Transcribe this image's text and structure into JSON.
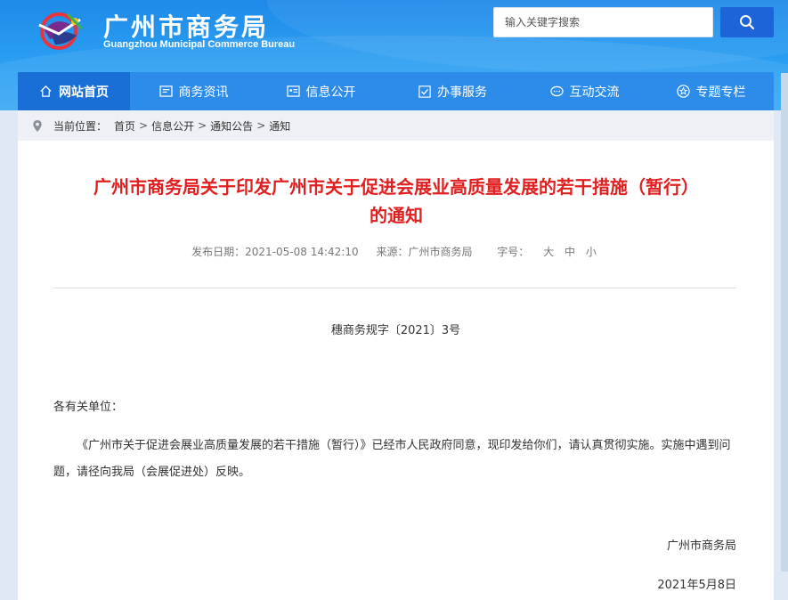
{
  "header": {
    "title": "广州市商务局",
    "subtitle": "Guangzhou Municipal Commerce Bureau",
    "search_placeholder": "输入关键字搜索"
  },
  "nav": {
    "items": [
      {
        "label": "网站首页",
        "icon": "home-icon",
        "active": true
      },
      {
        "label": "商务资讯",
        "icon": "news-icon",
        "active": false
      },
      {
        "label": "信息公开",
        "icon": "info-card-icon",
        "active": false
      },
      {
        "label": "办事服务",
        "icon": "checkbox-icon",
        "active": false
      },
      {
        "label": "互动交流",
        "icon": "chat-icon",
        "active": false
      },
      {
        "label": "专题专栏",
        "icon": "star-badge-icon",
        "active": false
      }
    ]
  },
  "breadcrumb": {
    "prefix": "当前位置：",
    "items": [
      "首页",
      "信息公开",
      "通知公告",
      "通知"
    ],
    "separator": ">"
  },
  "article": {
    "title_line1": "广州市商务局关于印发广州市关于促进会展业高质量发展的若干措施（暂行）",
    "title_line2": "的通知",
    "date": "发布日期：2021-05-08 14:42:10",
    "source": "来源：广州市商务局",
    "font_size_label": "字号：",
    "font_size_options": [
      "大",
      "中",
      "小"
    ],
    "doc_number": "穗商务规字〔2021〕3号",
    "salutation": "各有关单位：",
    "body": "《广州市关于促进会展业高质量发展的若干措施（暂行）》已经市人民政府同意，现印发给你们，请认真贯彻实施。实施中遇到问题，请径向我局（会展促进处）反映。",
    "signature": "广州市商务局",
    "sign_date": "2021年5月8日"
  },
  "colors": {
    "nav_bg": "#2d8ce9",
    "nav_active": "#1a6fd6",
    "title_red": "#e02020",
    "search_button": "#1c64d8"
  }
}
